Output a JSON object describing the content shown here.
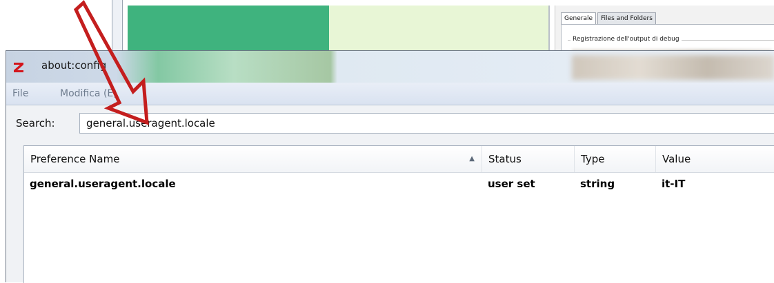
{
  "background_window": {
    "tabs": [
      {
        "label": "Generale",
        "active": true
      },
      {
        "label": "Files and Folders",
        "active": false
      }
    ],
    "group_label": "Registrazione dell'output di debug"
  },
  "window": {
    "title": "about:config",
    "icon": "zotero-z-icon",
    "menu": [
      {
        "label": "File"
      },
      {
        "label": "Modifica (E)"
      }
    ],
    "search": {
      "label": "Search:",
      "value": "general.useragent.locale"
    },
    "table": {
      "columns": [
        {
          "label": "Preference Name",
          "sorted": "ascending"
        },
        {
          "label": "Status"
        },
        {
          "label": "Type"
        },
        {
          "label": "Value"
        }
      ],
      "rows": [
        {
          "name": "general.useragent.locale",
          "status": "user set",
          "type": "string",
          "value": "it-IT"
        }
      ]
    }
  },
  "annotation": {
    "shape": "red-arrow",
    "color": "#c41e1e"
  }
}
